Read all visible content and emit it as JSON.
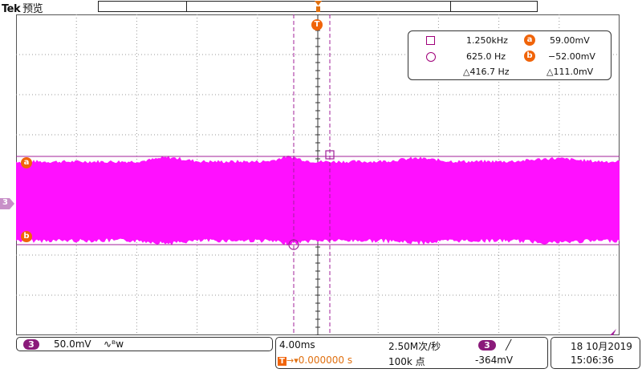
{
  "header": {
    "brand": "Tek",
    "mode": "预览"
  },
  "markers": {
    "trigger": "T",
    "cursor_a": "a",
    "cursor_b": "b",
    "channel": "3"
  },
  "cursor_readout": {
    "freq1": "1.250kHz",
    "freq2": "625.0 Hz",
    "delta_freq": "△416.7 Hz",
    "volt_a": "59.00mV",
    "volt_b": "−52.00mV",
    "delta_volt": "△111.0mV"
  },
  "vertical": {
    "channel": "3",
    "scale": "50.0mV",
    "coupling": "∿ᴮw"
  },
  "horizontal": {
    "timebase": "4.00ms",
    "sample_rate": "2.50M次/秒",
    "trigger_channel": "3",
    "trigger_slope": "╱",
    "trigger_pos_label": "T",
    "trigger_pos_value": "0.000000 s",
    "record_length": "100k 点",
    "trigger_level": "-364mV"
  },
  "datetime": {
    "date": "18 10月2019",
    "time": "15:06:36"
  },
  "colors": {
    "trace": "#ff10ff",
    "cursor": "#a0209a",
    "marker": "#f0640a",
    "badge": "#8a1a7a"
  }
}
